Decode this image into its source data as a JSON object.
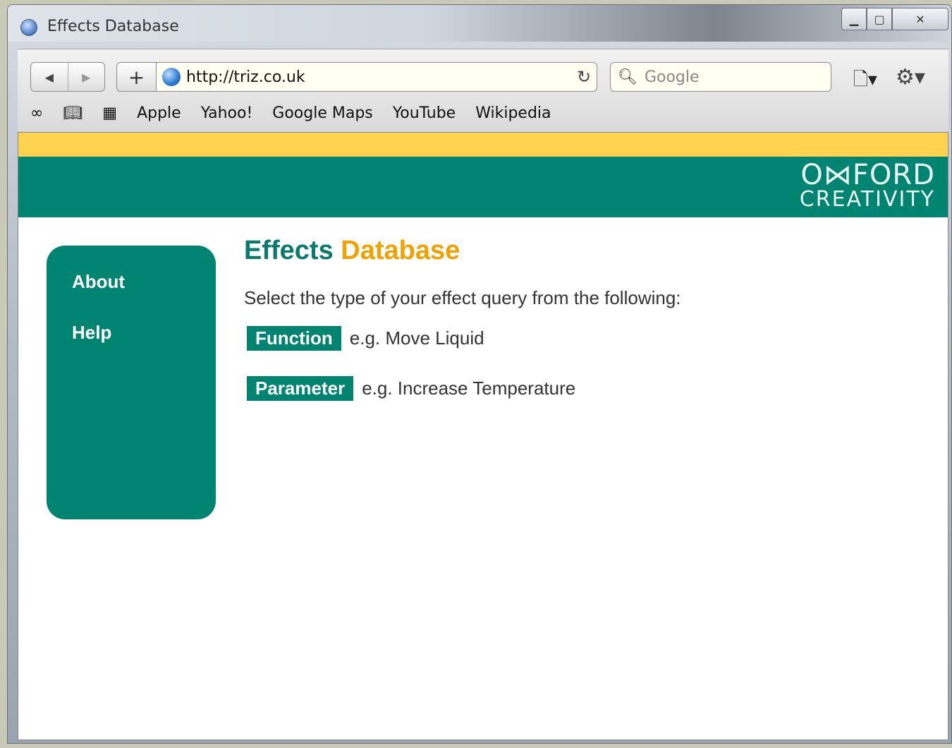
{
  "window": {
    "title": "Effects Database"
  },
  "toolbar": {
    "url": "http://triz.co.uk",
    "search_placeholder": "Google",
    "bookmarks": [
      "Apple",
      "Yahoo!",
      "Google Maps",
      "YouTube",
      "Wikipedia"
    ]
  },
  "logo": {
    "line1": "O⋈FORD",
    "line2": "CREATIVITY"
  },
  "sidebar": {
    "items": [
      {
        "label": "About"
      },
      {
        "label": "Help"
      }
    ]
  },
  "main": {
    "title_part1": "Effects",
    "title_part2": "Database",
    "intro": "Select the type of your effect query from the following:",
    "options": [
      {
        "label": "Function",
        "example": "e.g. Move Liquid"
      },
      {
        "label": "Parameter",
        "example": "e.g. Increase Temperature"
      }
    ]
  },
  "colors": {
    "brand_green": "#008472",
    "accent_yellow": "#ffd24f",
    "title_orange": "#f0a300"
  }
}
